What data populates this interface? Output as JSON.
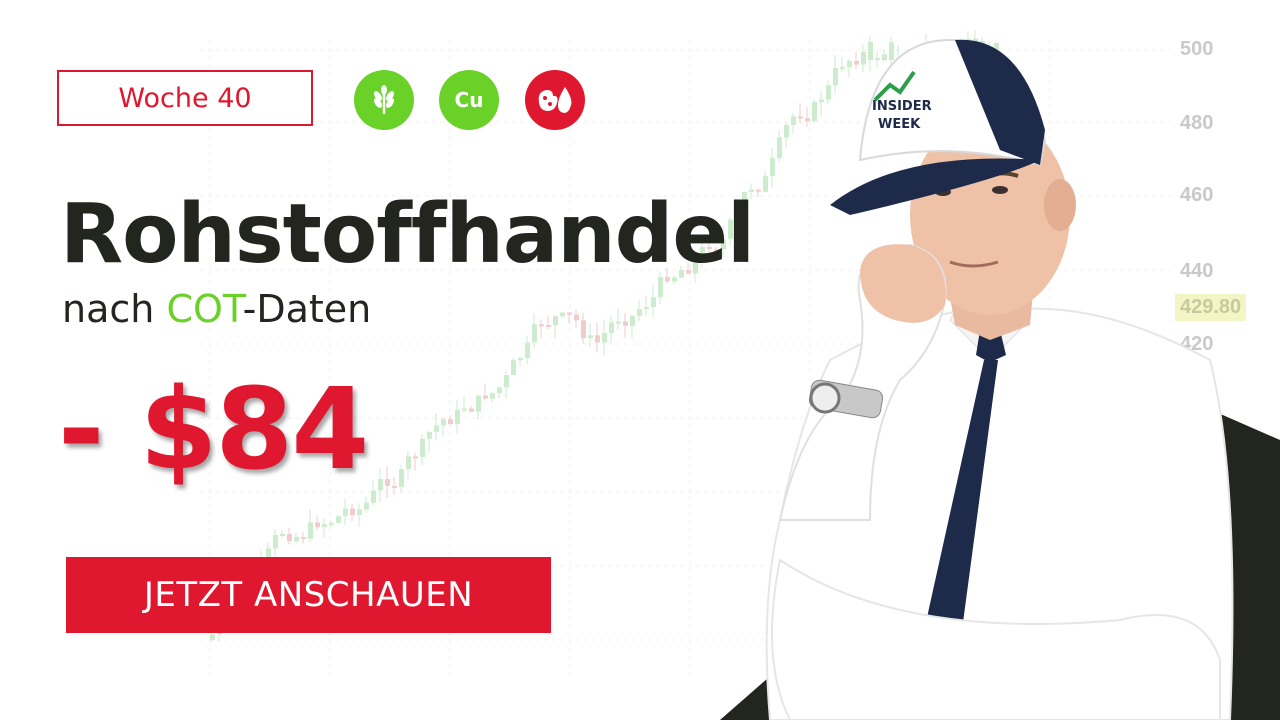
{
  "week_label": "Woche 40",
  "badges": [
    {
      "name": "grain-icon",
      "color": "#6ad129"
    },
    {
      "name": "copper-icon",
      "text": "Cu",
      "color": "#6ad129"
    },
    {
      "name": "soybean-oil-icon",
      "color": "#e0182f"
    }
  ],
  "headline": "Rohstoffhandel",
  "subline": {
    "prefix": "nach ",
    "highlight": "COT",
    "suffix": "-Daten"
  },
  "amount": "- $84",
  "cta_label": "JETZT ANSCHAUEN",
  "price_axis": [
    "500",
    "480",
    "460",
    "440",
    "420"
  ],
  "price_current": "429.80",
  "cap_text": [
    "INSIDER",
    "WEEK"
  ],
  "colors": {
    "accent_red": "#e0182f",
    "accent_green": "#6ad129",
    "dark": "#22261f"
  }
}
